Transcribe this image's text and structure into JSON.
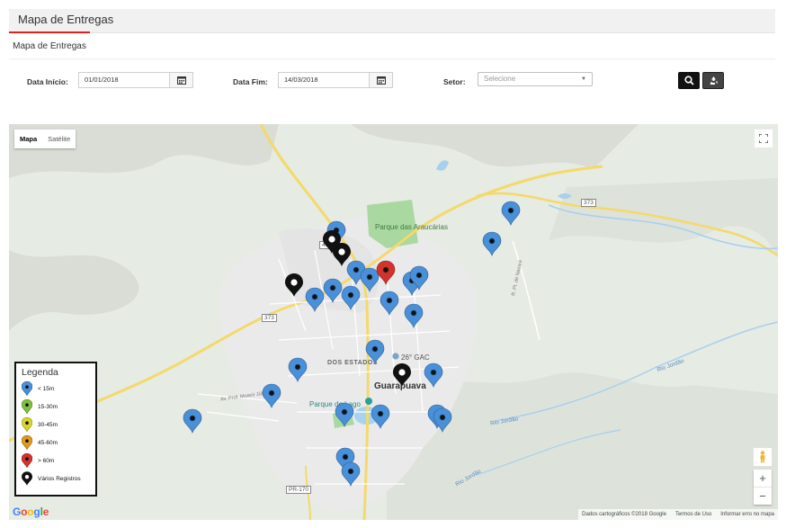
{
  "header": {
    "title": "Mapa de Entregas"
  },
  "tabs": [
    {
      "label": "Mapa de Entregas"
    }
  ],
  "filters": {
    "start_label": "Data Início:",
    "start_value": "01/01/2018",
    "end_label": "Data Fim:",
    "end_value": "14/03/2018",
    "sector_label": "Setor:",
    "sector_placeholder": "Selecione"
  },
  "map": {
    "type_map": "Mapa",
    "type_satellite": "Satélite",
    "labels": {
      "park_araucarias": "Parque das Araucárias",
      "gac": "26° GAC",
      "dos_estados": "DOS ESTADOS",
      "guarapuava": "Guarapuava",
      "parque_lago": "Parque do Lago",
      "rio_jordao_1": "Rio Jordão",
      "rio_jordao_2": "Rio Jordão",
      "rio_jordao_3": "Rio Jordão",
      "road_373a": "373",
      "road_373b": "373",
      "road_466": "466",
      "road_pr170": "PR-170",
      "street_prof": "Av. Prof. Moacir Júlio",
      "street_pt": "R. Pt. de Nazaré"
    },
    "attribution": {
      "data": "Dados cartográficos ©2018 Google",
      "terms": "Termos de Uso",
      "report": "Informar erro no mapa"
    },
    "google": "Google"
  },
  "legend": {
    "title": "Legenda",
    "items": [
      {
        "label": "< 15m",
        "color": "#4a90d9"
      },
      {
        "label": "15-30m",
        "color": "#7cc23a"
      },
      {
        "label": "30-45m",
        "color": "#d9d42a"
      },
      {
        "label": "45-60m",
        "color": "#e09a1c"
      },
      {
        "label": "> 60m",
        "color": "#d2332b"
      },
      {
        "label": "Vários Registros",
        "color": "#111111"
      }
    ]
  },
  "markers": {
    "blue_count": 27,
    "red_count": 1,
    "black_count": 4
  }
}
